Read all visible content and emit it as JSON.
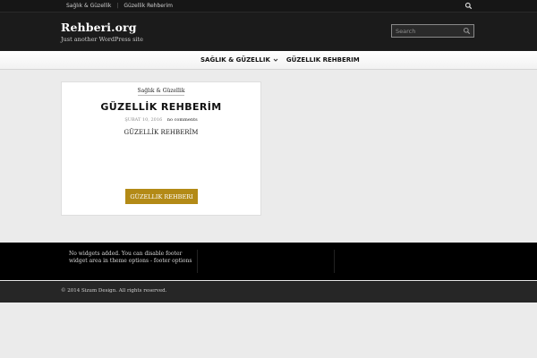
{
  "topbar": {
    "links": [
      "Sağlık & Güzellik",
      "Güzellik Rehberim"
    ],
    "separator": "|",
    "search_icon": "search-icon"
  },
  "header": {
    "site_title": "Rehberi.org",
    "tagline": "Just another WordPress site",
    "search": {
      "placeholder": "Search",
      "icon": "search-icon"
    }
  },
  "mainnav": {
    "items": [
      {
        "label": "SAĞLIK & GÜZELLIK",
        "has_dropdown": true
      },
      {
        "label": "GÜZELLIK REHBERIM",
        "has_dropdown": false
      }
    ]
  },
  "post": {
    "category": "Sağlık & Güzellik",
    "title": "GÜZELLİK REHBERİM",
    "date": "ŞUBAT 10, 2016",
    "comments": "no comments",
    "excerpt": "GÜZELLİK REHBERİM",
    "read_more": "GÜZELLIK REHBERI"
  },
  "footer": {
    "widget_text": "No widgets added. You can disable footer widget area in theme options - footer options",
    "copyright": "© 2014 Sizum Design. All rights reserved."
  },
  "colors": {
    "accent": "#b38a16",
    "header_bg": "#1b1b1b",
    "page_bg": "#ebebeb"
  }
}
